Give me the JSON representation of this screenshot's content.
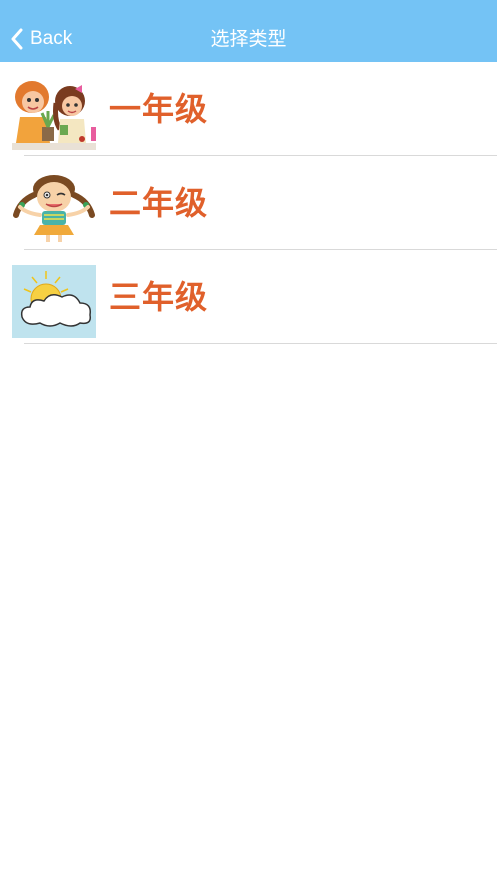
{
  "nav": {
    "back_label": "Back",
    "title": "选择类型",
    "background": "#74c3f5"
  },
  "grades": [
    {
      "label": "一年级",
      "icon": "two-girls-illustration"
    },
    {
      "label": "二年级",
      "icon": "pigtail-girl-illustration"
    },
    {
      "label": "三年级",
      "icon": "sun-behind-cloud-illustration"
    }
  ],
  "colors": {
    "label": "#e0602b",
    "divider": "#d9d9d9"
  }
}
